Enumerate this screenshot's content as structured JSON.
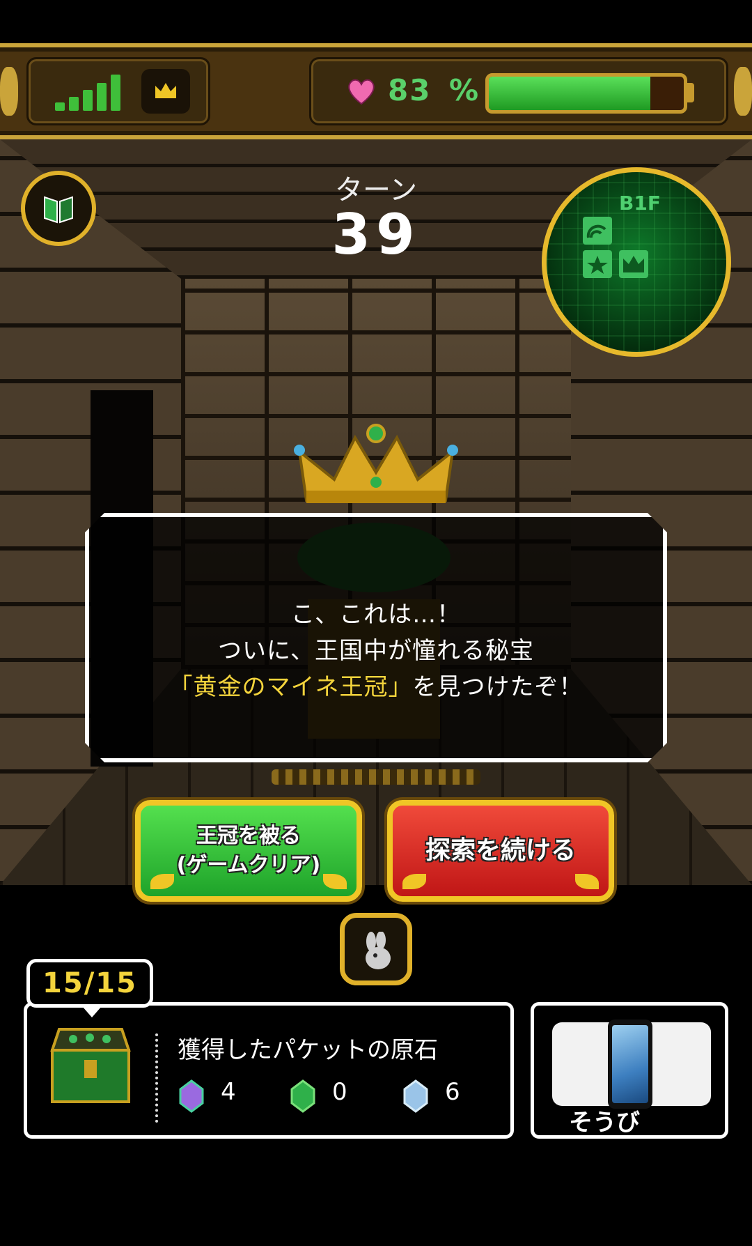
{
  "status": {
    "hp_percent_value": "83",
    "hp_unit": "%",
    "hp_fraction": 0.83,
    "signal_icon": "signal-bars-icon",
    "crown_icon": "crown-icon",
    "heart_icon": "heart-icon"
  },
  "hud": {
    "turn_label": "ターン",
    "turn_value": "39",
    "floor_label": "B1F",
    "book_icon": "book-icon"
  },
  "message": {
    "line1": "こ、これは…！",
    "line2": "ついに、王国中が憧れる秘宝",
    "line3_highlight": "「黄金のマイネ王冠」",
    "line3_rest": "を見つけたぞ！"
  },
  "choices": {
    "wear_crown_line1": "王冠を被る",
    "wear_crown_line2": "(ゲームクリア)",
    "continue_label": "探索を続ける"
  },
  "inventory": {
    "count": "15/15",
    "title": "獲得したパケットの原石",
    "gems": [
      {
        "icon": "rainbow-gem-icon",
        "count": "4",
        "color": "#9a6ae0"
      },
      {
        "icon": "green-gem-icon",
        "count": "0",
        "color": "#2fb04a"
      },
      {
        "icon": "blue-gem-icon",
        "count": "6",
        "color": "#9ac4e8"
      }
    ]
  },
  "equip": {
    "label": "そうび"
  },
  "colors": {
    "gold": "#e0b12a",
    "hp_green": "#5ad06a",
    "highlight_text": "#f4d43c",
    "button_green": "#2fc23a",
    "button_red": "#d81e1e"
  }
}
